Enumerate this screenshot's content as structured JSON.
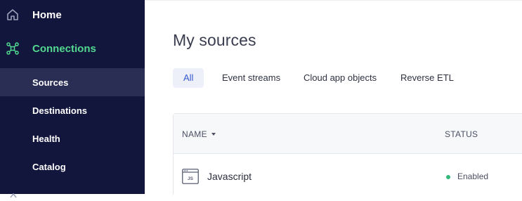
{
  "sidebar": {
    "home_label": "Home",
    "connections_label": "Connections",
    "items": [
      {
        "label": "Sources",
        "active": true
      },
      {
        "label": "Destinations",
        "active": false
      },
      {
        "label": "Health",
        "active": false
      },
      {
        "label": "Catalog",
        "active": false
      }
    ],
    "icons": {
      "home": "home-icon",
      "connections": "connections-icon"
    },
    "colors": {
      "background": "#12163d",
      "active_bg": "#2a2e55",
      "accent": "#52d88f"
    }
  },
  "main": {
    "title": "My sources",
    "tabs": [
      {
        "label": "All",
        "active": true
      },
      {
        "label": "Event streams",
        "active": false
      },
      {
        "label": "Cloud app objects",
        "active": false
      },
      {
        "label": "Reverse ETL",
        "active": false
      }
    ],
    "table": {
      "columns": {
        "name": "NAME",
        "status": "STATUS"
      },
      "sort_icon": "sort-caret-down-icon",
      "rows": [
        {
          "name": "Javascript",
          "icon": "js-source-icon",
          "icon_text": "JS",
          "status": "Enabled",
          "status_color": "#35b87a"
        }
      ]
    },
    "colors": {
      "tab_active": "#3457d5",
      "tab_active_bg": "#edf0f8"
    }
  }
}
